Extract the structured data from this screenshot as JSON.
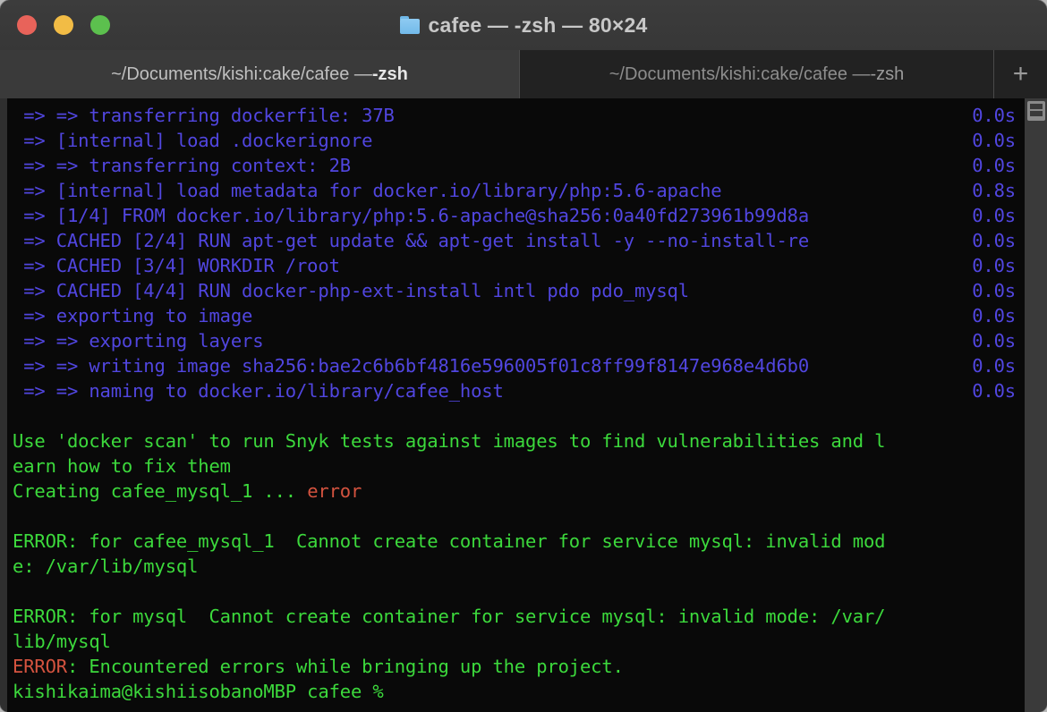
{
  "window": {
    "title": "cafee — -zsh — 80×24",
    "folder_icon": "folder-icon",
    "traffic_lights": {
      "close": "#e8635a",
      "minimize": "#f2bc45",
      "maximize": "#5cc04e"
    }
  },
  "tabs": [
    {
      "label_path": "~/Documents/kishi:cake/cafee — ",
      "label_shell": "-zsh",
      "active": true
    },
    {
      "label_path": "~/Documents/kishi:cake/cafee — ",
      "label_shell": "-zsh",
      "active": false
    }
  ],
  "new_tab": {
    "label": "+"
  },
  "split_icon": "split-pane-icon",
  "colors": {
    "terminal_background": "#090909",
    "blue_text": "#5146e0",
    "green_text": "#3cd93c",
    "red_text": "#d4533f",
    "titlebar": "#3a3a3a",
    "tabbar_inactive": "#222222"
  },
  "terminal": {
    "lines": [
      {
        "segments": [
          {
            "text": " => => transferring dockerfile: 37B",
            "color": "blue"
          }
        ],
        "time": "0.0s"
      },
      {
        "segments": [
          {
            "text": " => [internal] load .dockerignore",
            "color": "blue"
          }
        ],
        "time": "0.0s"
      },
      {
        "segments": [
          {
            "text": " => => transferring context: 2B",
            "color": "blue"
          }
        ],
        "time": "0.0s"
      },
      {
        "segments": [
          {
            "text": " => [internal] load metadata for docker.io/library/php:5.6-apache",
            "color": "blue"
          }
        ],
        "time": "0.8s"
      },
      {
        "segments": [
          {
            "text": " => [1/4] FROM docker.io/library/php:5.6-apache@sha256:0a40fd273961b99d8a",
            "color": "blue"
          }
        ],
        "time": "0.0s"
      },
      {
        "segments": [
          {
            "text": " => CACHED [2/4] RUN apt-get update && apt-get install -y --no-install-re",
            "color": "blue"
          }
        ],
        "time": "0.0s"
      },
      {
        "segments": [
          {
            "text": " => CACHED [3/4] WORKDIR /root",
            "color": "blue"
          }
        ],
        "time": "0.0s"
      },
      {
        "segments": [
          {
            "text": " => CACHED [4/4] RUN docker-php-ext-install intl pdo pdo_mysql",
            "color": "blue"
          }
        ],
        "time": "0.0s"
      },
      {
        "segments": [
          {
            "text": " => exporting to image",
            "color": "blue"
          }
        ],
        "time": "0.0s"
      },
      {
        "segments": [
          {
            "text": " => => exporting layers",
            "color": "blue"
          }
        ],
        "time": "0.0s"
      },
      {
        "segments": [
          {
            "text": " => => writing image sha256:bae2c6b6bf4816e596005f01c8ff99f8147e968e4d6b0",
            "color": "blue"
          }
        ],
        "time": "0.0s"
      },
      {
        "segments": [
          {
            "text": " => => naming to docker.io/library/cafee_host",
            "color": "blue"
          }
        ],
        "time": "0.0s"
      },
      {
        "segments": [],
        "time": ""
      },
      {
        "segments": [
          {
            "text": "Use 'docker scan' to run Snyk tests against images to find vulnerabilities and l",
            "color": "green"
          }
        ],
        "time": ""
      },
      {
        "segments": [
          {
            "text": "earn how to fix them",
            "color": "green"
          }
        ],
        "time": ""
      },
      {
        "segments": [
          {
            "text": "Creating cafee_mysql_1 ... ",
            "color": "green"
          },
          {
            "text": "error",
            "color": "red"
          }
        ],
        "time": ""
      },
      {
        "segments": [],
        "time": ""
      },
      {
        "segments": [
          {
            "text": "ERROR: for cafee_mysql_1  Cannot create container for service mysql: invalid mod",
            "color": "green"
          }
        ],
        "time": ""
      },
      {
        "segments": [
          {
            "text": "e: /var/lib/mysql",
            "color": "green"
          }
        ],
        "time": ""
      },
      {
        "segments": [],
        "time": ""
      },
      {
        "segments": [
          {
            "text": "ERROR: for mysql  Cannot create container for service mysql: invalid mode: /var/",
            "color": "green"
          }
        ],
        "time": ""
      },
      {
        "segments": [
          {
            "text": "lib/mysql",
            "color": "green"
          }
        ],
        "time": ""
      },
      {
        "segments": [
          {
            "text": "ERROR",
            "color": "red"
          },
          {
            "text": ": Encountered errors while bringing up the project.",
            "color": "green"
          }
        ],
        "time": ""
      },
      {
        "segments": [
          {
            "text": "kishikaima@kishiisobanoMBP cafee %",
            "color": "green"
          }
        ],
        "time": ""
      }
    ]
  }
}
